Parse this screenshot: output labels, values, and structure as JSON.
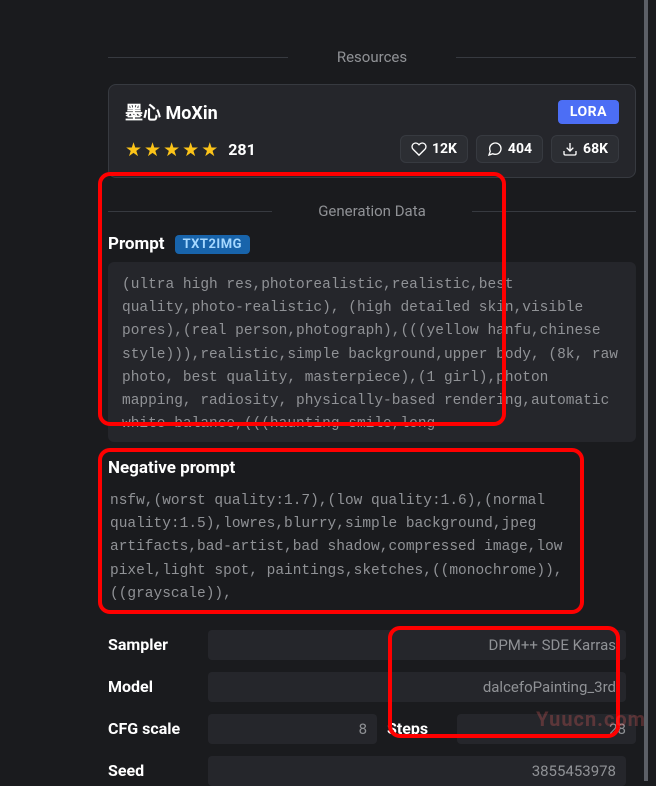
{
  "sections": {
    "resources_title": "Resources",
    "generation_title": "Generation Data"
  },
  "resource": {
    "name": "墨心 MoXin",
    "type_badge": "LORA",
    "rating_count": "281",
    "likes": "12K",
    "comments": "404",
    "downloads": "68K"
  },
  "prompt": {
    "label": "Prompt",
    "type_badge": "TXT2IMG",
    "text": "(ultra high res,photorealistic,realistic,best quality,photo-realistic), (high detailed skin,visible pores),(real person,photograph),(((yellow hanfu,chinese style))),realistic,simple background,upper body, (8k, raw photo, best quality, masterpiece),(1 girl),photon mapping, radiosity, physically-based rendering,automatic white balance,(((haunting smile,long"
  },
  "negative": {
    "label": "Negative prompt",
    "text": "nsfw,(worst quality:1.7),(low quality:1.6),(normal quality:1.5),lowres,blurry,simple background,jpeg artifacts,bad-artist,bad shadow,compressed image,low pixel,light spot, paintings,sketches,((monochrome)),((grayscale)),"
  },
  "params": {
    "sampler_label": "Sampler",
    "sampler_value": "DPM++ SDE Karras",
    "model_label": "Model",
    "model_value": "dalcefoPainting_3rd",
    "cfg_label": "CFG scale",
    "cfg_value": "8",
    "steps_label": "Steps",
    "steps_value": "28",
    "seed_label": "Seed",
    "seed_value": "3855453978"
  },
  "watermark": "Yuucn.com"
}
